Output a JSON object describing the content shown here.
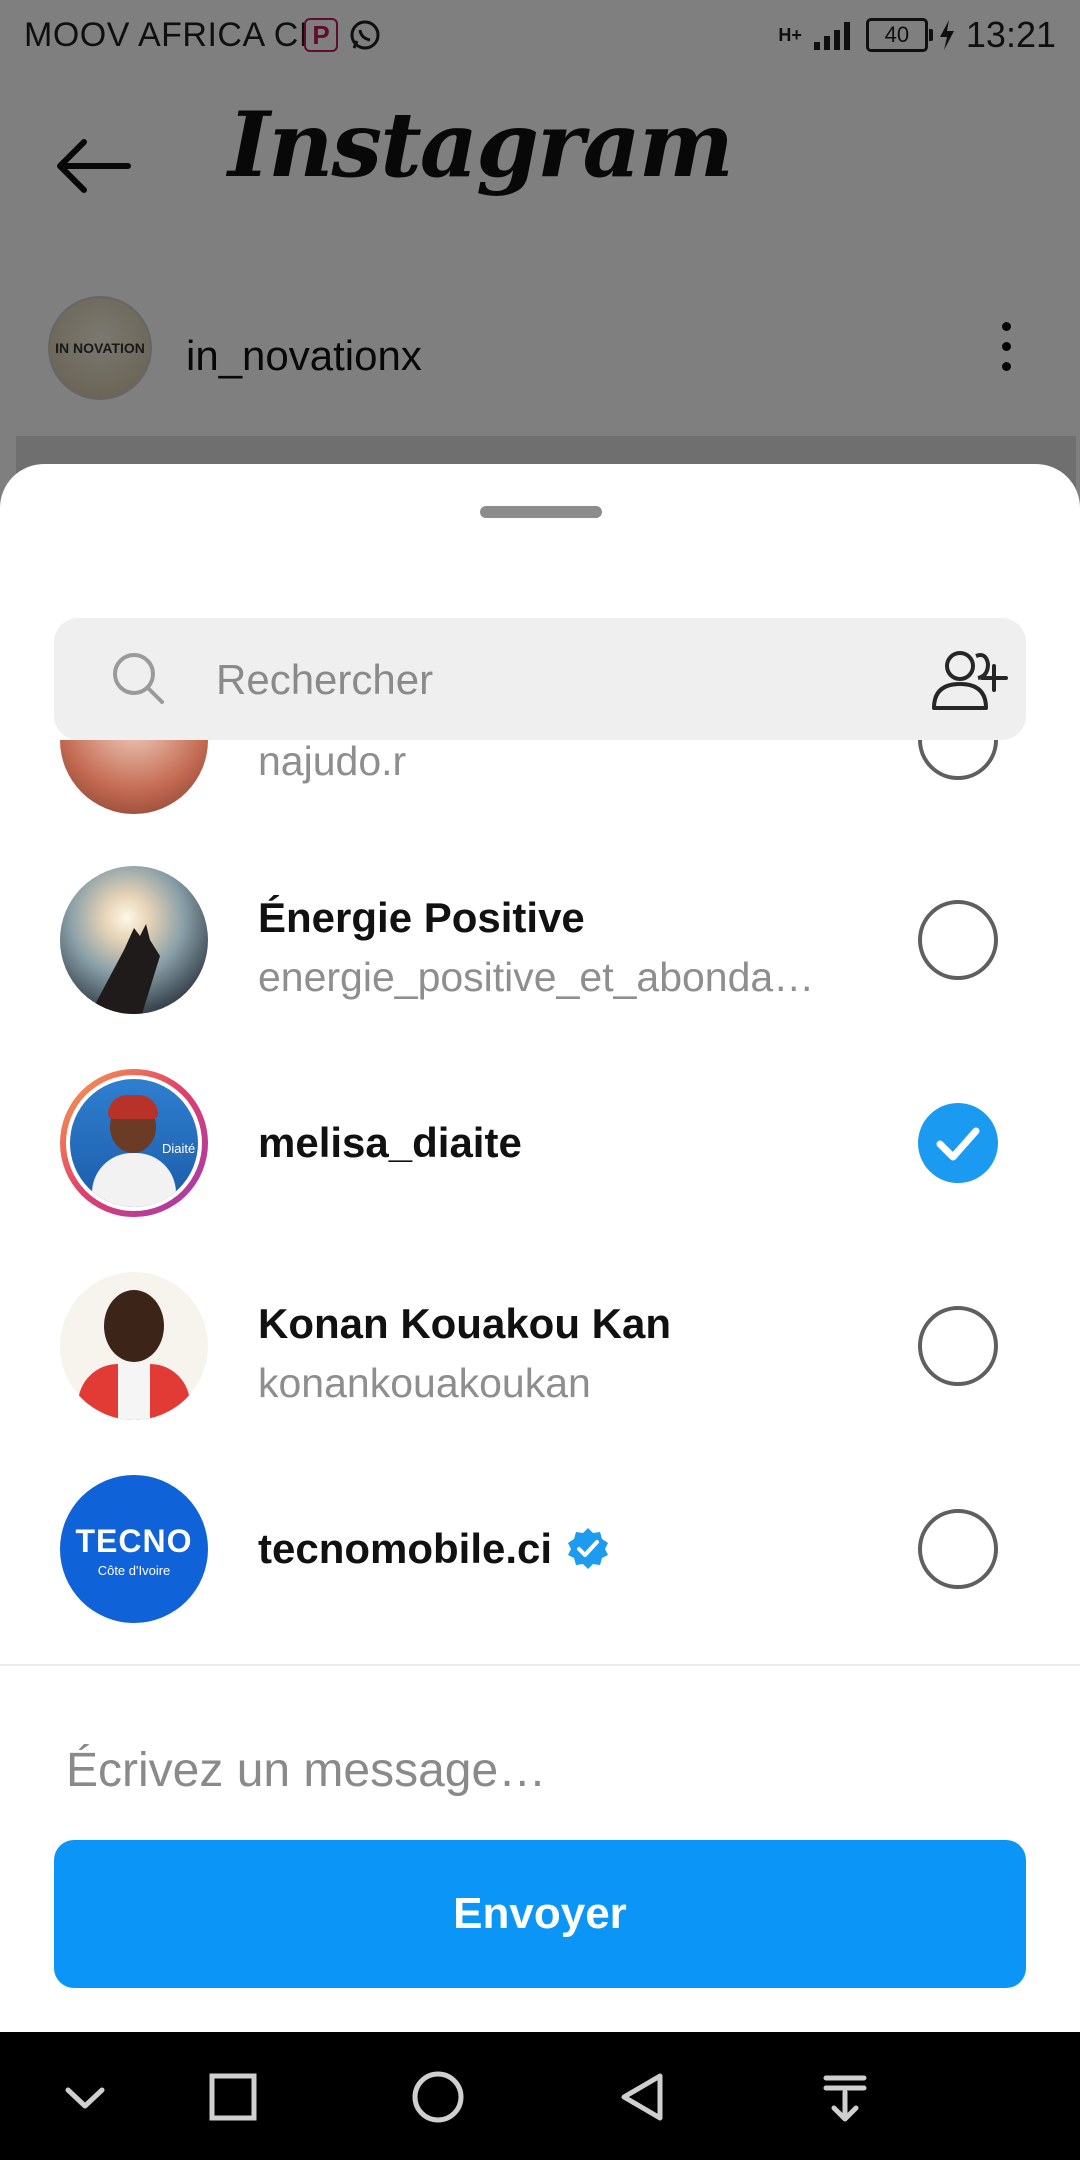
{
  "status_bar": {
    "carrier": "MOOV AFRICA CI",
    "battery": "40",
    "time": "13:21",
    "network": "H+"
  },
  "app_bar": {
    "logo": "Instagram",
    "back_icon": "back-arrow-icon"
  },
  "profile": {
    "avatar_text": "IN NOVATION",
    "username": "in_novationx",
    "more_icon": "more-vertical-icon"
  },
  "share_sheet": {
    "search": {
      "placeholder": "Rechercher",
      "value": ""
    },
    "contacts": [
      {
        "name": "",
        "username": "najudo.r",
        "selected": false,
        "verified": false
      },
      {
        "name": "Énergie Positive",
        "username": "energie_positive_et_abonda…",
        "selected": false,
        "verified": false
      },
      {
        "name": "melisa_diaite",
        "username": "",
        "selected": true,
        "verified": false,
        "avatar_caption": "Diaité"
      },
      {
        "name": "Konan Kouakou Kan",
        "username": "konankouakoukan",
        "selected": false,
        "verified": false
      },
      {
        "name": "tecnomobile.ci",
        "username": "",
        "selected": false,
        "verified": true,
        "avatar_title": "TECNO",
        "avatar_subtitle": "Côte d'Ivoire"
      }
    ],
    "message": {
      "placeholder": "Écrivez un message…",
      "value": ""
    },
    "send_label": "Envoyer"
  },
  "colors": {
    "accent": "#0b95f6",
    "checked": "#1a9af0",
    "verified": "#1d9bf0"
  }
}
